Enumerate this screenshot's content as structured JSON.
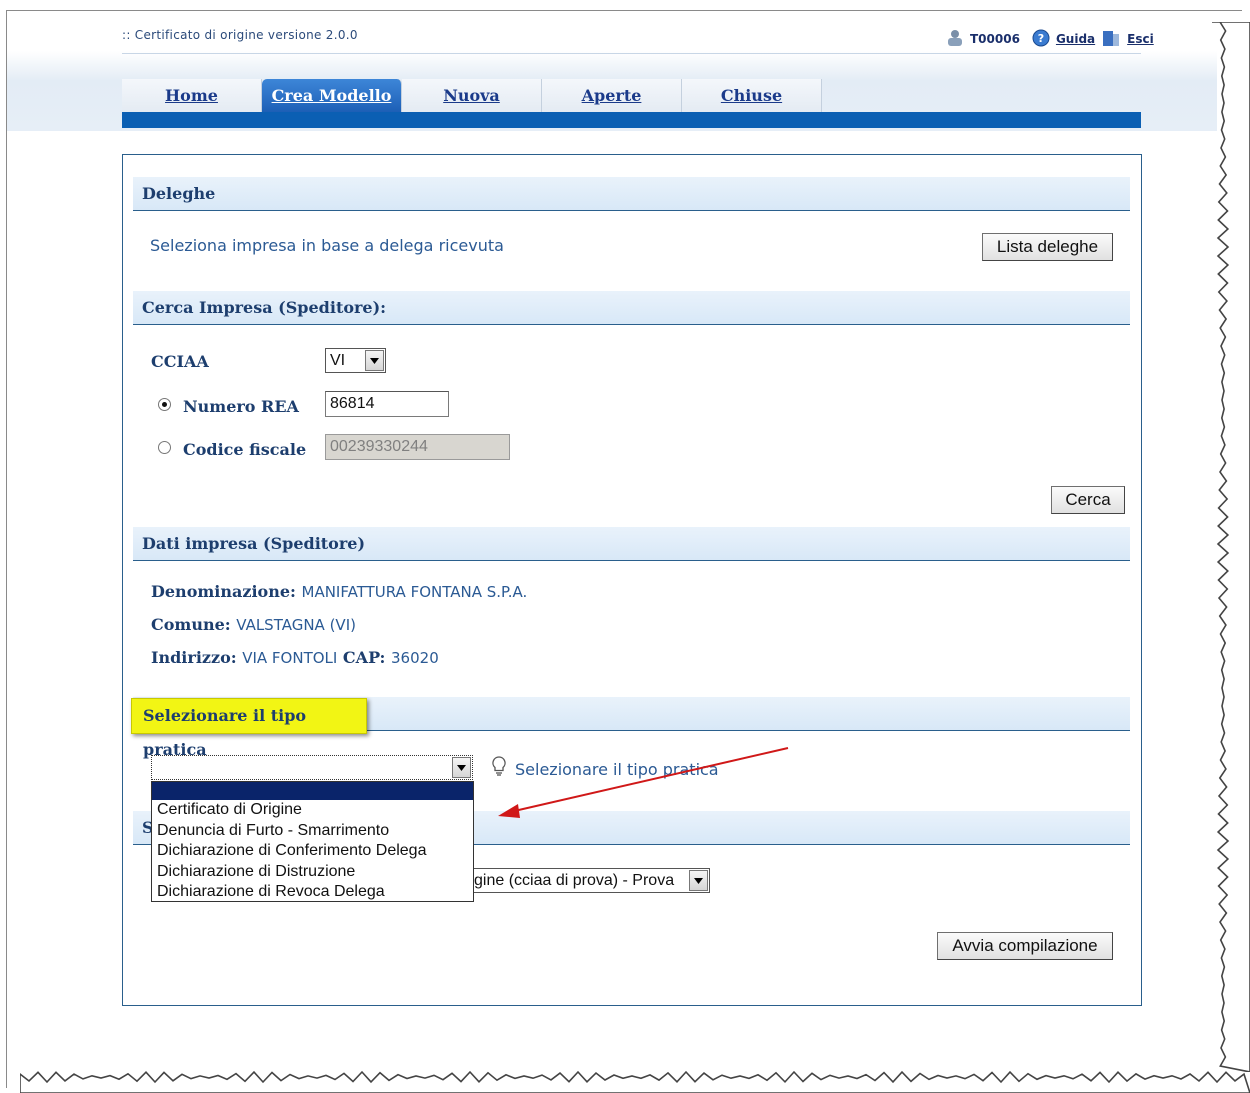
{
  "app_title": ":: Certificato di origine versione 2.0.0",
  "user_bar": {
    "user_code": "T00006",
    "help_label": "Guida",
    "exit_label": "Esci"
  },
  "tabs": [
    {
      "label": "Home",
      "active": false
    },
    {
      "label": "Crea Modello",
      "active": true
    },
    {
      "label": "Nuova",
      "active": false
    },
    {
      "label": "Aperte",
      "active": false
    },
    {
      "label": "Chiuse",
      "active": false
    }
  ],
  "deleghe": {
    "heading": "Deleghe",
    "description": "Seleziona impresa in base a delega ricevuta",
    "button_label": "Lista deleghe"
  },
  "cerca_impresa": {
    "heading": "Cerca Impresa (Speditore):",
    "cciaa_label": "CCIAA",
    "cciaa_value": "VI",
    "numero_rea_label": "Numero REA",
    "numero_rea_value": "86814",
    "numero_rea_selected": true,
    "codice_fiscale_label": "Codice fiscale",
    "codice_fiscale_value": "00239330244",
    "search_button_label": "Cerca"
  },
  "dati_impresa": {
    "heading": "Dati impresa (Speditore)",
    "denominazione_label": "Denominazione:",
    "denominazione_value": "MANIFATTURA FONTANA S.P.A.",
    "comune_label": "Comune:",
    "comune_value": "VALSTAGNA  (VI)",
    "indirizzo_label": "Indirizzo:",
    "indirizzo_value": "VIA FONTOLI",
    "cap_label": "CAP:",
    "cap_value": "36020"
  },
  "tipo_pratica": {
    "heading": "Selezionare il tipo pratica",
    "hint": "Selezionare il tipo pratica",
    "selected_value": "",
    "options": [
      "Certificato di Origine",
      "Denuncia di Furto - Smarrimento",
      "Dichiarazione di Conferimento Delega",
      "Dichiarazione di Distruzione",
      "Dichiarazione di Revoca Delega"
    ]
  },
  "partially_hidden": {
    "section_heading_initial": "S",
    "select_value_visible": "gine (cciaa di prova) - Prova"
  },
  "start_button_label": "Avvia compilazione",
  "colors": {
    "tab_active": "#2a6fc9",
    "tab_strip": "#0b5fb3",
    "section_text": "#1d3e6e",
    "value_text": "#2b5a94",
    "highlight": "#f2f514",
    "arrow": "#d01818"
  }
}
